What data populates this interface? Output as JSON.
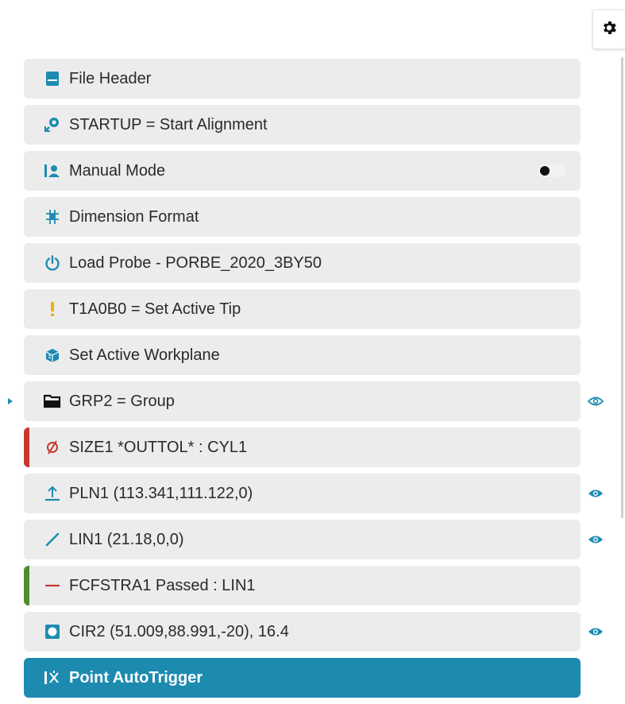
{
  "colors": {
    "accent": "#1d8bb0",
    "fail": "#c6372e",
    "pass": "#4e8c2f",
    "card_bg": "#ececec"
  },
  "toolbar": {
    "settings_icon": "gear-icon"
  },
  "items": [
    {
      "label": "File Header",
      "icon": "document-icon"
    },
    {
      "label": "STARTUP = Start Alignment",
      "icon": "alignment-icon"
    },
    {
      "label": "Manual Mode",
      "icon": "manual-mode-icon",
      "toggle": false
    },
    {
      "label": "Dimension Format",
      "icon": "dimension-format-icon"
    },
    {
      "label": "Load Probe - PORBE_2020_3BY50",
      "icon": "power-icon"
    },
    {
      "label": "T1A0B0 = Set Active Tip",
      "icon": "exclamation-icon"
    },
    {
      "label": "Set Active Workplane",
      "icon": "workplane-icon"
    },
    {
      "label": "GRP2 = Group",
      "icon": "folder-icon",
      "expander": "collapsed",
      "eye": "outline"
    },
    {
      "label": "SIZE1 *OUTTOL* : CYL1",
      "icon": "diameter-icon",
      "status": "fail"
    },
    {
      "label": "PLN1 (113.341,111.122,0)",
      "icon": "plane-icon",
      "eye": "filled"
    },
    {
      "label": "LIN1 (21.18,0,0)",
      "icon": "line-icon",
      "eye": "filled"
    },
    {
      "label": "FCFSTRA1 Passed : LIN1",
      "icon": "straightness-icon",
      "status": "pass"
    },
    {
      "label": "CIR2 (51.009,88.991,-20), 16.4",
      "icon": "circle-icon",
      "eye": "filled"
    },
    {
      "label": "Point AutoTrigger",
      "icon": "point-autotrigger-icon",
      "active": true
    }
  ]
}
